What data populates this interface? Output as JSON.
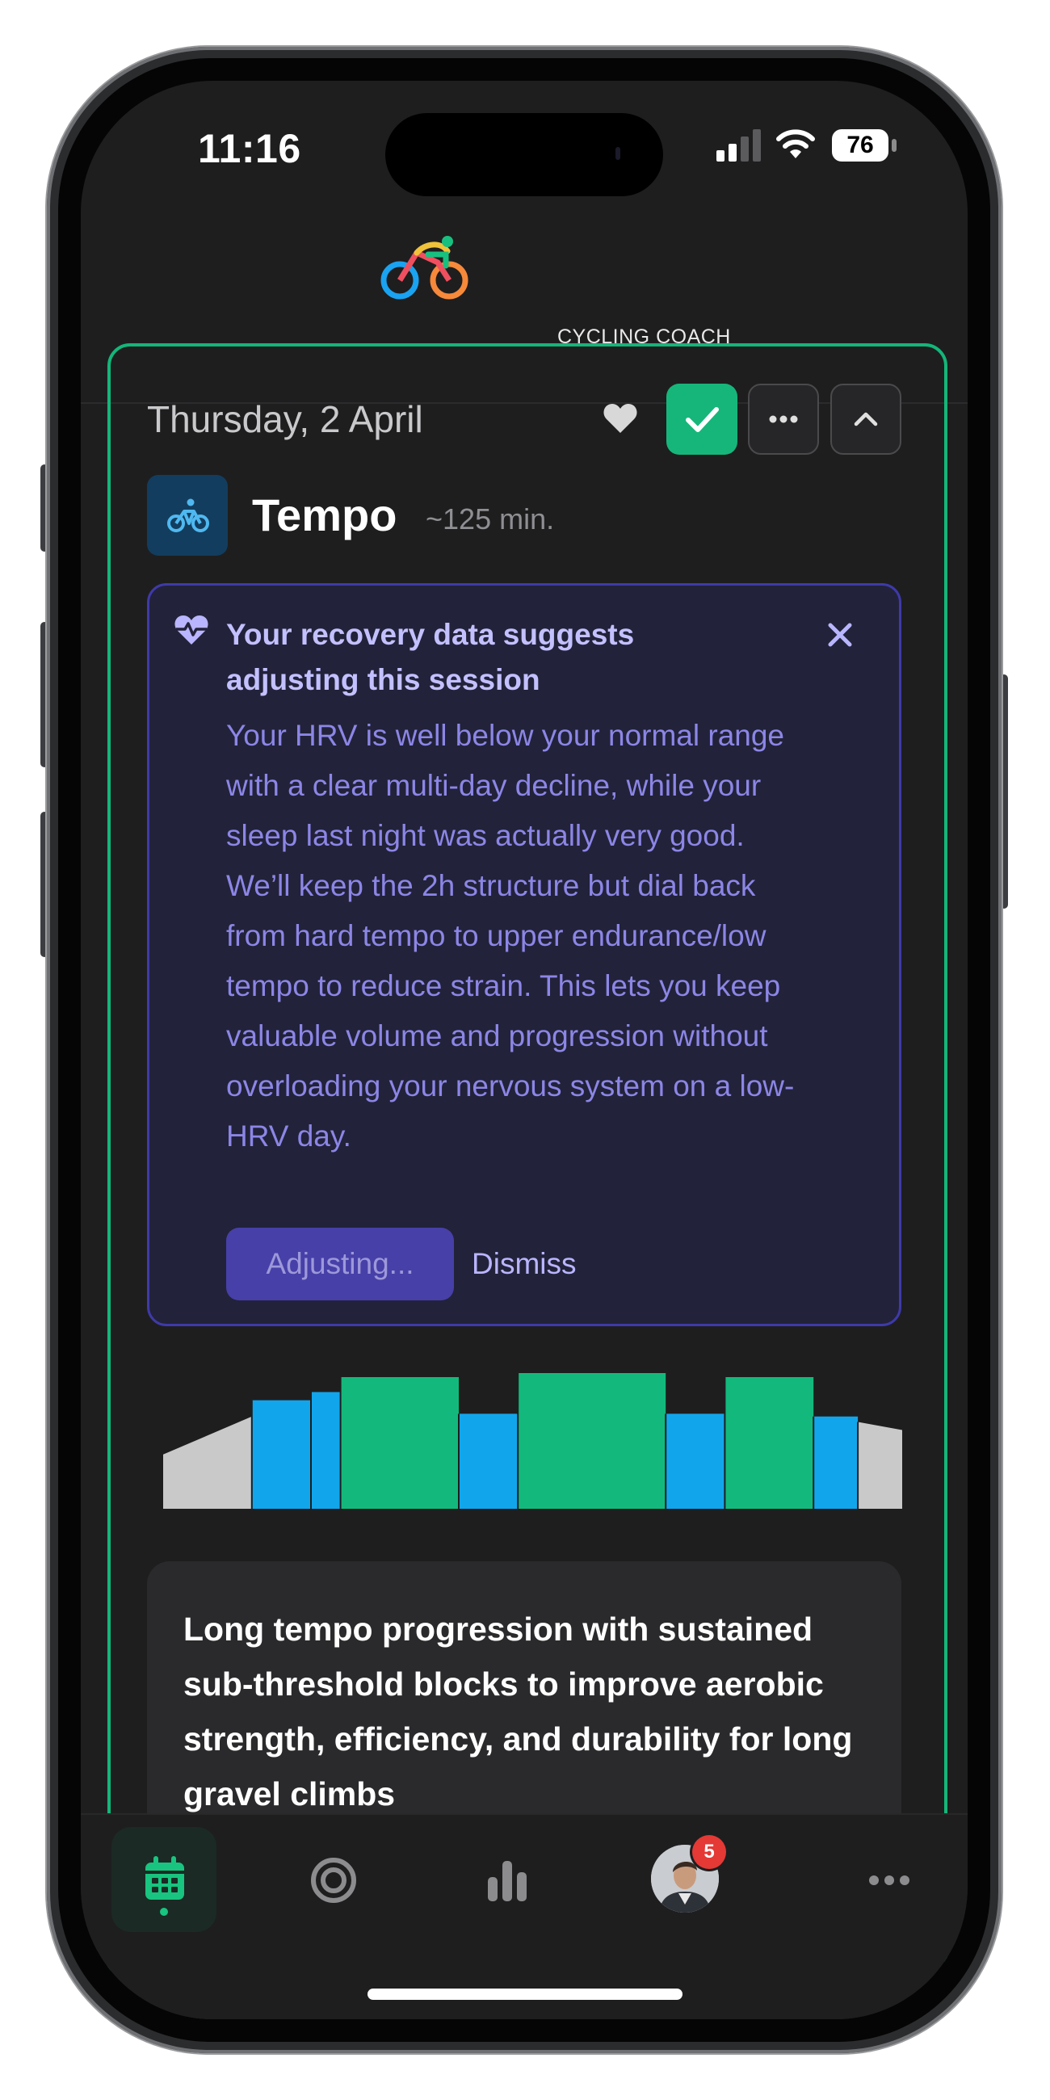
{
  "status_bar": {
    "time": "11:16",
    "battery": "76"
  },
  "header": {
    "brand": "CYCLING COACH"
  },
  "workout": {
    "date": "Thursday, 2 April",
    "type": "Tempo",
    "duration": "~125 min.",
    "accent_color": "#14b679"
  },
  "recovery_alert": {
    "title": "Your recovery data suggests adjusting this session",
    "body": "Your HRV is well below your normal range with a clear multi-day decline, while your sleep last night was actually very good. We’ll keep the 2h structure but dial back from hard tempo to upper endurance/low tempo to reduce strain. This lets you keep valuable volume and progression without overloading your nervous system on a low-HRV day.",
    "adjust_label": "Adjusting...",
    "dismiss_label": "Dismiss"
  },
  "workout_profile": {
    "zone_colors": {
      "warmup": "#c9c9c9",
      "endurance": "#11a6ec",
      "tempo": "#13b97c"
    },
    "segments": [
      {
        "zone": "warmup",
        "duration": 12,
        "intensity_start": 0.4,
        "intensity_end": 0.68
      },
      {
        "zone": "endurance",
        "duration": 8,
        "intensity": 0.8
      },
      {
        "zone": "endurance",
        "duration": 4,
        "intensity": 0.86
      },
      {
        "zone": "tempo",
        "duration": 16,
        "intensity": 0.97
      },
      {
        "zone": "endurance",
        "duration": 8,
        "intensity": 0.7
      },
      {
        "zone": "tempo",
        "duration": 20,
        "intensity": 1.0
      },
      {
        "zone": "endurance",
        "duration": 8,
        "intensity": 0.7
      },
      {
        "zone": "tempo",
        "duration": 12,
        "intensity": 0.97
      },
      {
        "zone": "endurance",
        "duration": 6,
        "intensity": 0.68
      },
      {
        "zone": "warmup",
        "duration": 6,
        "intensity_start": 0.64,
        "intensity_end": 0.58
      }
    ]
  },
  "description": "Long tempo progression with sustained sub-threshold blocks to improve aerobic strength, efficiency, and durability for long gravel climbs",
  "tabbar": {
    "tabs": [
      {
        "id": "calendar",
        "icon": "calendar-icon",
        "active": true
      },
      {
        "id": "goals",
        "icon": "target-icon"
      },
      {
        "id": "stats",
        "icon": "bar-chart-icon"
      },
      {
        "id": "coach",
        "icon": "avatar",
        "badge": "5"
      },
      {
        "id": "more",
        "icon": "more-dots-icon"
      }
    ]
  }
}
